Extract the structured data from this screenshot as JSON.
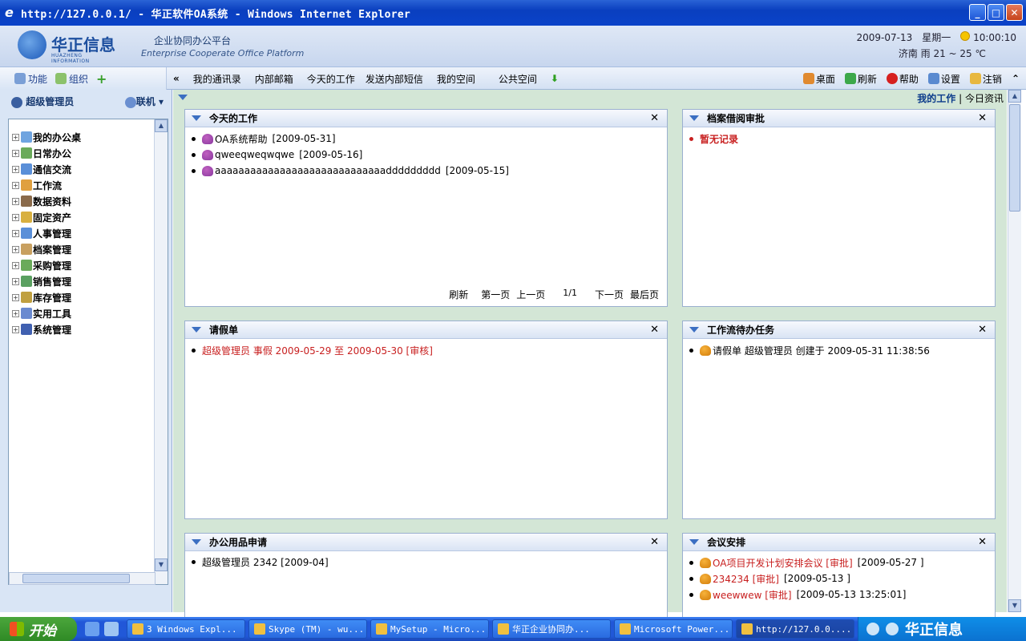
{
  "window": {
    "title": "http://127.0.0.1/ - 华正软件OA系统 - Windows Internet Explorer",
    "min": "_",
    "max": "□",
    "close": "✕"
  },
  "header": {
    "logo_cn": "华正信息",
    "logo_en": "HUAZHENG INFORMATION",
    "platform_cn": "企业协同办公平台",
    "platform_en": "Enterprise Cooperate Office Platform",
    "date": "2009-07-13",
    "weekday": "星期一",
    "time": "10:00:10",
    "weather": "济南  雨  21 ~ 25 ℃"
  },
  "navleft": {
    "func": "功能",
    "org": "组织",
    "add": "+"
  },
  "navmenu": {
    "collapse": "«",
    "items": [
      "我的通讯录",
      "内部邮箱",
      "今天的工作",
      "发送内部短信",
      "我的空间",
      "公共空间"
    ]
  },
  "navright": {
    "desktop": "桌面",
    "refresh": "刷新",
    "help": "帮助",
    "settings": "设置",
    "logout": "注销",
    "up": "⌃"
  },
  "sidebar": {
    "user": "超级管理员",
    "status": "联机",
    "tree": [
      "我的办公桌",
      "日常办公",
      "通信交流",
      "工作流",
      "数据资料",
      "固定资产",
      "人事管理",
      "档案管理",
      "采购管理",
      "销售管理",
      "库存管理",
      "实用工具",
      "系统管理"
    ]
  },
  "topbar": {
    "my_work": "我的工作",
    "sep": "|",
    "today_news": "今日资讯"
  },
  "panels": {
    "today": {
      "title": "今天的工作",
      "items": [
        {
          "text": "OA系统帮助",
          "date": "[2009-05-31]"
        },
        {
          "text": "qweeqweqwqwe",
          "date": "[2009-05-16]"
        },
        {
          "text": "aaaaaaaaaaaaaaaaaaaaaaaaaaaaaddddddddd",
          "date": "[2009-05-15]"
        }
      ],
      "pager": {
        "refresh": "刷新",
        "first": "第一页",
        "prev": "上一页",
        "page": "1/1",
        "next": "下一页",
        "last": "最后页"
      }
    },
    "archive": {
      "title": "档案借阅审批",
      "empty": "暂无记录"
    },
    "leave": {
      "title": "请假单",
      "items": [
        {
          "text": "超级管理员  事假  2009-05-29 至  2009-05-30   [审核]"
        }
      ]
    },
    "workflow": {
      "title": "工作流待办任务",
      "items": [
        {
          "text": "请假单  超级管理员  创建于  2009-05-31 11:38:56"
        }
      ]
    },
    "supplies": {
      "title": "办公用品申请",
      "items": [
        {
          "text": "超级管理员  2342  [2009-04]"
        }
      ]
    },
    "meeting": {
      "title": "会议安排",
      "items": [
        {
          "text": "OA项目开发计划安排会议  [审批]",
          "date": "[2009-05-27 ]"
        },
        {
          "text": "234234  [审批]",
          "date": "[2009-05-13 ]"
        },
        {
          "text": "weewwew  [审批]",
          "date": "[2009-05-13 13:25:01]"
        }
      ]
    },
    "close": "✕"
  },
  "taskbar": {
    "start": "开始",
    "tasks": [
      "3 Windows Expl...",
      "Skype (TM) - wu...",
      "MySetup - Micro...",
      "华正企业协同办...",
      "Microsoft Power...",
      "http://127.0.0...."
    ],
    "brand": "华正信息"
  }
}
